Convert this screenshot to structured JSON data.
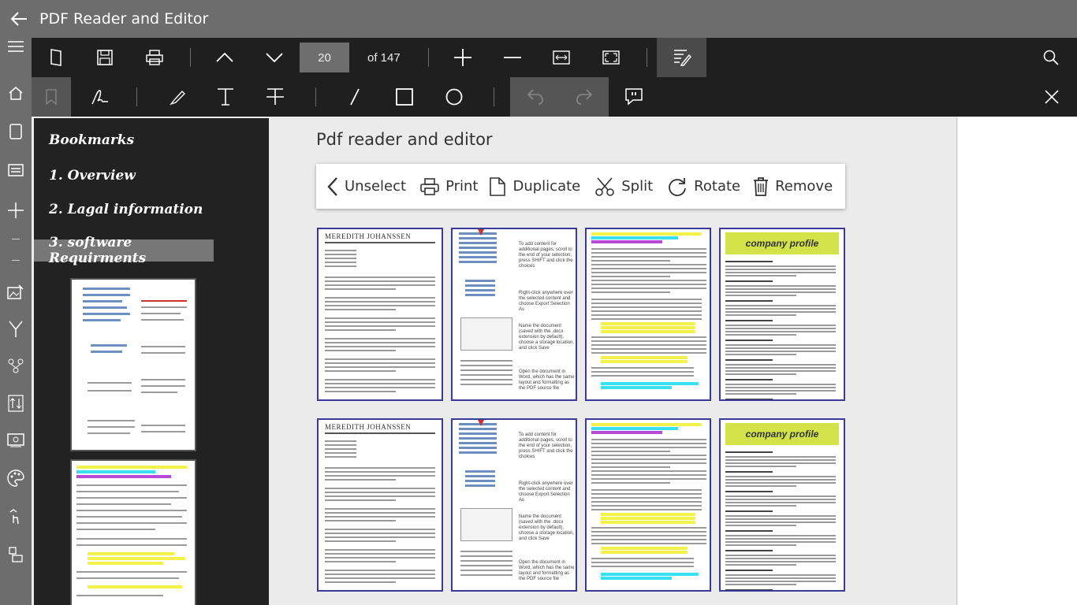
{
  "app": {
    "title": "PDF Reader and Editor"
  },
  "toolbar": {
    "current_page": "20",
    "of_pages": "of 147"
  },
  "sidebar": {
    "bookmarks": [
      {
        "label": "Bookmarks"
      },
      {
        "label": "1. Overview"
      },
      {
        "label": "2. Lagal information"
      },
      {
        "label": "3. software Requirments"
      }
    ]
  },
  "main": {
    "title": "Pdf reader and editor",
    "actions": [
      {
        "label": "Unselect"
      },
      {
        "label": "Print"
      },
      {
        "label": "Duplicate"
      },
      {
        "label": "Split"
      },
      {
        "label": "Rotate"
      },
      {
        "label": "Remove"
      }
    ],
    "pages": [
      {
        "kind": "letter",
        "header": "MEREDITH JOHANSSEN"
      },
      {
        "kind": "guide",
        "steps": [
          "To add content for additional pages, scroll to the end of your selection, press SHIFT and click the choices",
          "Right-click anywhere over the selected content and choose Export Selection As",
          "Name the document (saved with the .docx extension by default), choose a storage location, and click Save",
          "Open the document in Word, which has the same layout and formatting as the PDF source file"
        ]
      },
      {
        "kind": "article"
      },
      {
        "kind": "profile",
        "header": "company profile"
      },
      {
        "kind": "letter",
        "header": "MEREDITH JOHANSSEN"
      },
      {
        "kind": "guide",
        "steps": [
          "To add content for additional pages, scroll to the end of your selection, press SHIFT and click the choices",
          "Right-click anywhere over the selected content and choose Export Selection As",
          "Name the document (saved with the .docx extension by default), choose a storage location, and click Save",
          "Open the document in Word, which has the same layout and formatting as the PDF source file"
        ]
      },
      {
        "kind": "article"
      },
      {
        "kind": "profile",
        "header": "company profile"
      }
    ]
  },
  "colors": {
    "titlebar": "#6d6d6d",
    "toolbar": "#1f1f1f",
    "sidebar": "#222222",
    "card_border": "#3a3a9a",
    "highlight_yellow": "#f2f24a",
    "highlight_cyan": "#38e0f0",
    "highlight_purple": "#b84ad8"
  }
}
